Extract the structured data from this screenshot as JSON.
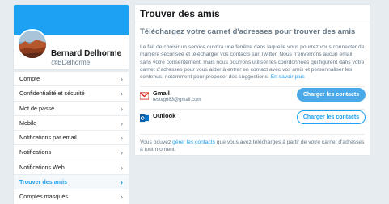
{
  "profile": {
    "name": "Bernard Delhorme",
    "handle": "@BDelhorme"
  },
  "menu": {
    "items": [
      {
        "label": "Compte"
      },
      {
        "label": "Confidentialité et sécurité"
      },
      {
        "label": "Mot de passe"
      },
      {
        "label": "Mobile"
      },
      {
        "label": "Notifications par email"
      },
      {
        "label": "Notifications"
      },
      {
        "label": "Notifications Web"
      },
      {
        "label": "Trouver des amis",
        "active": true
      },
      {
        "label": "Comptes masqués"
      }
    ],
    "chevron": "›"
  },
  "main": {
    "header": "Trouver des amis",
    "section_title": "Téléchargez votre carnet d'adresses pour trouver des amis",
    "description": "Le fait de choisir un service ouvrira une fenêtre dans laquelle vous pourrez vous connecter de manière sécurisée et télécharger vos contacts sur Twitter. Nous n'enverrons aucun email sans votre consentement, mais nous pourrons utiliser les coordonnées qui figurent dans votre carnet d'adresses pour vous aider à entrer en contact avec vos amis et personnaliser les contenus, notamment pour proposer des suggestions.",
    "learn_more": "En savoir plus",
    "providers": [
      {
        "name": "Gmail",
        "email": "testvg683@gmail.com",
        "button": "Charger les contacts",
        "icon": "gmail-icon"
      },
      {
        "name": "Outlook",
        "email": "",
        "button": "Charger les contacts",
        "icon": "outlook-icon"
      }
    ],
    "footer_prefix": "Vous pouvez ",
    "footer_link": "gérer les contacts",
    "footer_suffix": " que vous avez téléchargés à partir de votre carnet d'adresses à tout moment."
  },
  "colors": {
    "accent": "#1da1f2",
    "background": "#e6ecf0",
    "muted_text": "#657786"
  }
}
